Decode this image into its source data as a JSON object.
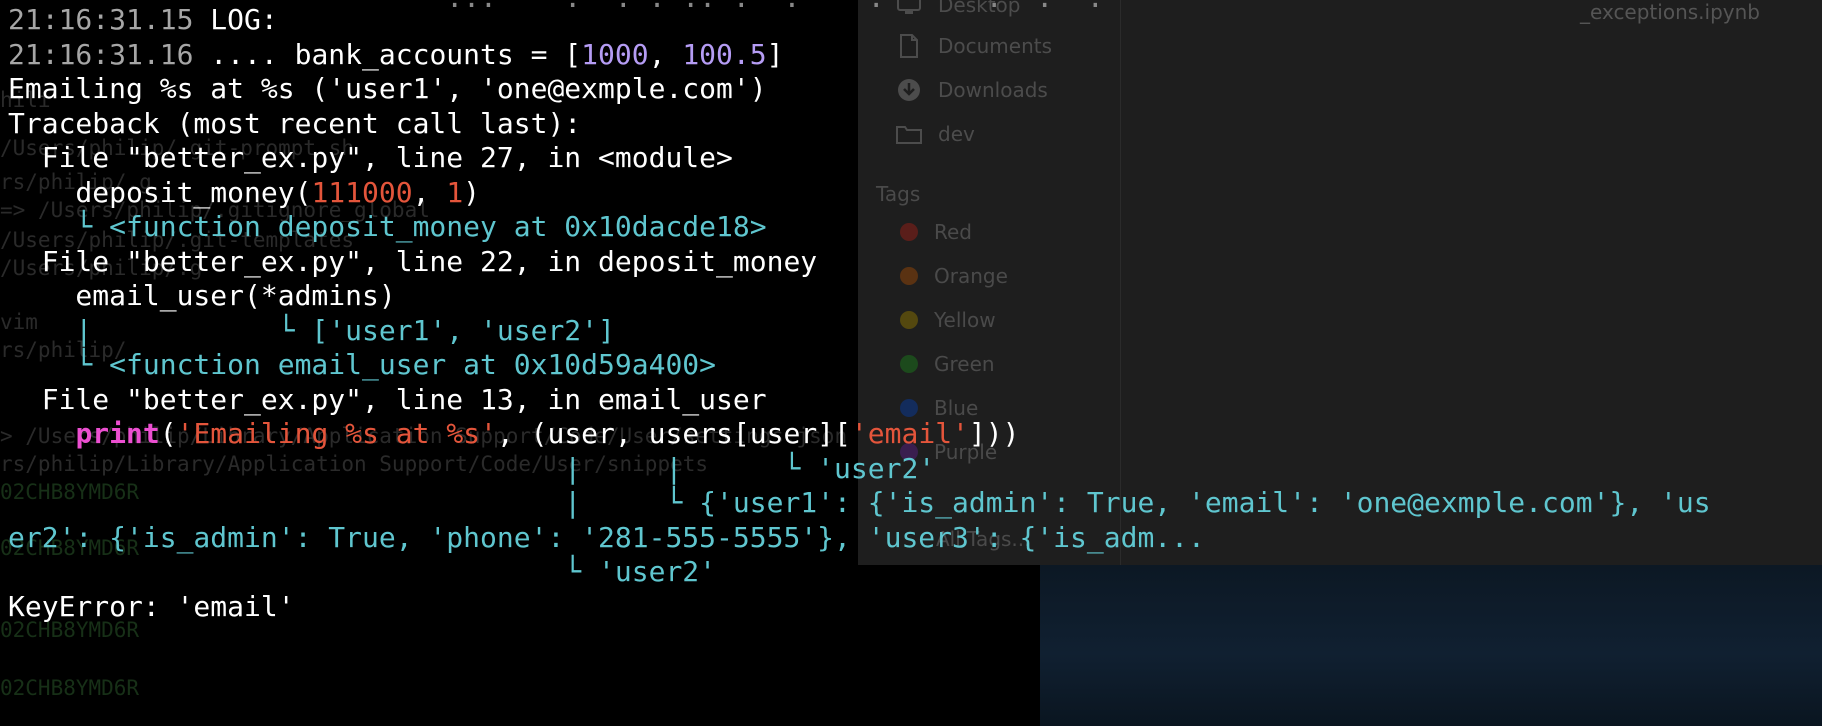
{
  "finder": {
    "sidebar_items": [
      {
        "label": "Desktop",
        "icon": "desktop-icon"
      },
      {
        "label": "Documents",
        "icon": "document-icon"
      },
      {
        "label": "Downloads",
        "icon": "download-icon"
      },
      {
        "label": "dev",
        "icon": "folder-icon"
      }
    ],
    "tags_heading": "Tags",
    "tags": [
      {
        "label": "Red",
        "color": "#5a1e1a"
      },
      {
        "label": "Orange",
        "color": "#5a3212"
      },
      {
        "label": "Yellow",
        "color": "#54480f"
      },
      {
        "label": "Green",
        "color": "#1c4a1c"
      },
      {
        "label": "Blue",
        "color": "#132c5c"
      },
      {
        "label": "Purple",
        "color": "#3a1e4f"
      }
    ],
    "all_tags": "All Tags...",
    "file_name": "_exceptions.ipynb"
  },
  "ghost_text": [
    "hili",
    "/Users/philip/.git-prompt.sh",
    "rs/philip/.g",
    "=> /Users/philip/.gitignore_global",
    "/Users/philip/.git-templates",
    "/Users/philip/.g",
    "vim",
    "rs/philip/",
    "> /Users/philip/Library/Application Support/Code/User/settings.json",
    "rs/philip/Library/Application Support/Code/User/snippets",
    "02CHB8YMD6R",
    "02CHB8YMD6R",
    "02CHB8YMD6R",
    "02CHB8YMD6R"
  ],
  "terminal": {
    "partial_top": "                          ...    .  . . .. .  .    .      .  .  .",
    "lines": [
      [
        {
          "t": "21:16:31.15",
          "c": "dim"
        },
        {
          "t": " LOG:",
          "c": "white"
        }
      ],
      [
        {
          "t": "21:16:31.16",
          "c": "dim"
        },
        {
          "t": " .... bank_accounts = [",
          "c": "white"
        },
        {
          "t": "1000",
          "c": "purple"
        },
        {
          "t": ", ",
          "c": "white"
        },
        {
          "t": "100.5",
          "c": "purple"
        },
        {
          "t": "]",
          "c": "white"
        }
      ],
      [
        {
          "t": "Emailing %s at %s ('user1', 'one@exmple.com')",
          "c": "white"
        }
      ],
      [
        {
          "t": "Traceback (most recent call last):",
          "c": "white"
        }
      ],
      [
        {
          "t": "  File \"better_ex.py\", line 27, in <module>",
          "c": "white"
        }
      ],
      [
        {
          "t": "    deposit_money(",
          "c": "white"
        },
        {
          "t": "111000",
          "c": "red"
        },
        {
          "t": ", ",
          "c": "white"
        },
        {
          "t": "1",
          "c": "red"
        },
        {
          "t": ")",
          "c": "white"
        }
      ],
      [
        {
          "t": "    └ <function deposit_money at 0x10dacde18>",
          "c": "cyan"
        }
      ],
      [
        {
          "t": "  File \"better_ex.py\", line 22, in deposit_money",
          "c": "white"
        }
      ],
      [
        {
          "t": "    email_user(*admins)",
          "c": "white"
        }
      ],
      [
        {
          "t": "    |           └ ['user1', 'user2']",
          "c": "cyan"
        }
      ],
      [
        {
          "t": "    └ <function email_user at 0x10d59a400>",
          "c": "cyan"
        }
      ],
      [
        {
          "t": "  File \"better_ex.py\", line 13, in email_user",
          "c": "white"
        }
      ],
      [
        {
          "t": "    ",
          "c": "white"
        },
        {
          "t": "print",
          "c": "magenta"
        },
        {
          "t": "(",
          "c": "white"
        },
        {
          "t": "'Emailing %s at %s'",
          "c": "red"
        },
        {
          "t": ", (user, users[user][",
          "c": "white"
        },
        {
          "t": "'email'",
          "c": "red"
        },
        {
          "t": "]))",
          "c": "white"
        }
      ],
      [
        {
          "t": "                                 |     |      └ 'user2'",
          "c": "cyan"
        }
      ],
      [
        {
          "t": "                                 |     └ {'user1': {'is_admin': True, 'email': 'one@exmple.com'}, 'us",
          "c": "cyan"
        }
      ],
      [
        {
          "t": "er2': {'is_admin': True, 'phone': '281-555-5555'}, 'user3': {'is_adm...",
          "c": "cyan"
        }
      ],
      [
        {
          "t": "                                 └ 'user2'",
          "c": "cyan"
        }
      ],
      [
        {
          "t": "KeyError: 'email'",
          "c": "white"
        }
      ]
    ]
  }
}
